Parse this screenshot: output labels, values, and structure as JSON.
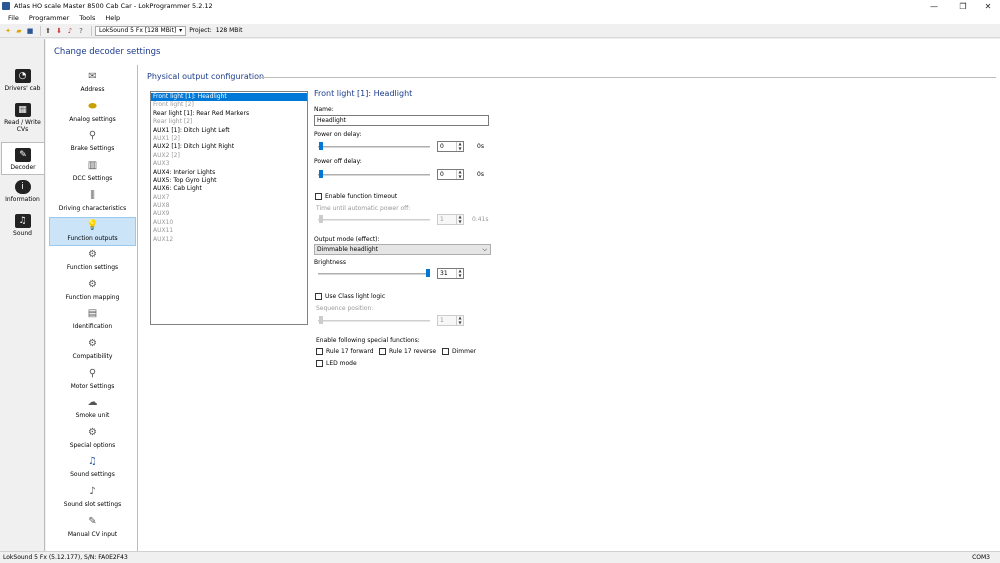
{
  "window": {
    "title": "Atlas HO scale Master 8500 Cab Car - LokProgrammer 5.2.12",
    "min": "—",
    "max": "❐",
    "close": "✕"
  },
  "menu": [
    "File",
    "Programmer",
    "Tools",
    "Help"
  ],
  "toolbar": {
    "decoder_select": "LokSound 5 Fx [128 MBit]",
    "project_label": "Project:",
    "project_size": "128 MBit"
  },
  "leftnav": [
    {
      "label": "Drivers' cab",
      "icon": "drivers-cab-icon"
    },
    {
      "label": "Read / Write CVs",
      "icon": "read-write-cvs-icon"
    },
    {
      "label": "Decoder",
      "icon": "decoder-icon"
    },
    {
      "label": "Information",
      "icon": "information-icon"
    },
    {
      "label": "Sound",
      "icon": "sound-icon"
    }
  ],
  "page_title": "Change decoder settings",
  "categories": [
    {
      "label": "Address",
      "icon": "envelope-icon"
    },
    {
      "label": "Analog settings",
      "icon": "analog-icon"
    },
    {
      "label": "Brake Settings",
      "icon": "brake-icon"
    },
    {
      "label": "DCC Settings",
      "icon": "dcc-icon"
    },
    {
      "label": "Driving characteristics",
      "icon": "sliders-icon"
    },
    {
      "label": "Function outputs",
      "icon": "lightbulb-icon"
    },
    {
      "label": "Function settings",
      "icon": "function-settings-icon"
    },
    {
      "label": "Function mapping",
      "icon": "function-mapping-icon"
    },
    {
      "label": "Identification",
      "icon": "identification-icon"
    },
    {
      "label": "Compatibility",
      "icon": "compatibility-icon"
    },
    {
      "label": "Motor Settings",
      "icon": "motor-icon"
    },
    {
      "label": "Smoke unit",
      "icon": "smoke-icon"
    },
    {
      "label": "Special options",
      "icon": "special-options-icon"
    },
    {
      "label": "Sound settings",
      "icon": "sound-settings-icon"
    },
    {
      "label": "Sound slot settings",
      "icon": "sound-slot-icon"
    },
    {
      "label": "Manual CV input",
      "icon": "manual-cv-icon"
    }
  ],
  "section_title": "Physical output configuration",
  "outputs": [
    {
      "label": "Front light [1]: Headlight",
      "state": "selected"
    },
    {
      "label": "Front light [2]",
      "state": "disabled"
    },
    {
      "label": "Rear light [1]: Rear Red Markers",
      "state": "normal"
    },
    {
      "label": "Rear light [2]",
      "state": "disabled"
    },
    {
      "label": "AUX1 [1]: Ditch Light Left",
      "state": "normal"
    },
    {
      "label": "AUX1 [2]",
      "state": "disabled"
    },
    {
      "label": "AUX2 [1]: Ditch Light Right",
      "state": "normal"
    },
    {
      "label": "AUX2 [2]",
      "state": "disabled"
    },
    {
      "label": "AUX3",
      "state": "disabled"
    },
    {
      "label": "AUX4: Interior Lights",
      "state": "normal"
    },
    {
      "label": "AUX5: Top Gyro Light",
      "state": "normal"
    },
    {
      "label": "AUX6: Cab Light",
      "state": "normal"
    },
    {
      "label": "AUX7",
      "state": "disabled"
    },
    {
      "label": "AUX8",
      "state": "disabled"
    },
    {
      "label": "AUX9",
      "state": "disabled"
    },
    {
      "label": "AUX10",
      "state": "disabled"
    },
    {
      "label": "AUX11",
      "state": "disabled"
    },
    {
      "label": "AUX12",
      "state": "disabled"
    }
  ],
  "detail": {
    "heading": "Front light [1]: Headlight",
    "name_label": "Name:",
    "name_value": "Headlight",
    "power_on_label": "Power on delay:",
    "power_on_value": "0",
    "power_on_unit": "0s",
    "power_off_label": "Power off delay:",
    "power_off_value": "0",
    "power_off_unit": "0s",
    "enable_timeout_label": "Enable function timeout",
    "timeout_label": "Time until automatic power off:",
    "timeout_value": "1",
    "timeout_unit": "0.41s",
    "output_mode_label": "Output mode (effect):",
    "output_mode_value": "Dimmable headlight",
    "brightness_label": "Brightness",
    "brightness_value": "31",
    "brightness_level": 31,
    "brightness_max": 31,
    "class_light_label": "Use Class light logic",
    "sequence_label": "Sequence position:",
    "sequence_value": "1",
    "special_label": "Enable following special functions:",
    "rule17_fwd": "Rule 17 forward",
    "rule17_rev": "Rule 17 reverse",
    "dimmer": "Dimmer",
    "led_mode": "LED mode"
  },
  "status": {
    "left": "LokSound 5 Fx (5.12.177), S/N: FA0E2F43",
    "right": "COM3"
  },
  "colors": {
    "accent": "#0078d7",
    "heading": "#1a3a8c",
    "selection": "#cce4f7"
  }
}
